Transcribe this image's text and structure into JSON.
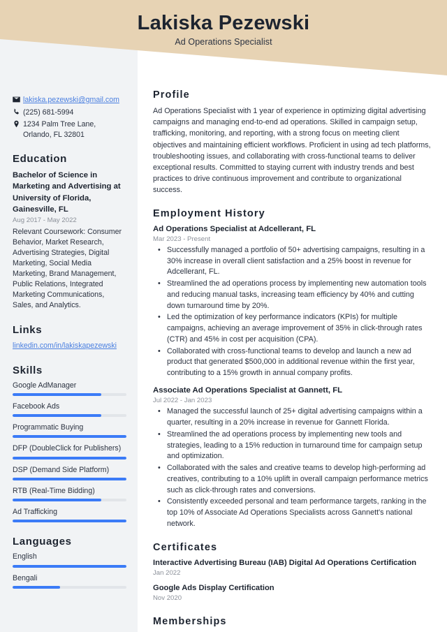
{
  "header": {
    "name": "Lakiska Pezewski",
    "job_title": "Ad Operations Specialist",
    "banner_color": "#E7D3B4"
  },
  "sidebar": {
    "contact": [
      {
        "icon": "envelope-icon",
        "text": "lakiska.pezewski@gmail.com",
        "is_link": true
      },
      {
        "icon": "phone-icon",
        "text": "(225) 681-5994",
        "is_link": false
      },
      {
        "icon": "location-pin-icon",
        "text": "1234 Palm Tree Lane, Orlando, FL 32801",
        "is_link": false
      }
    ],
    "contact_address_line1": "1234 Palm Tree Lane,",
    "contact_address_line2": "Orlando, FL 32801",
    "education": {
      "heading": "Education",
      "entries": [
        {
          "title": "Bachelor of Science in Marketing and Advertising at University of Florida, Gainesville, FL",
          "date": "Aug 2017 - May 2022",
          "description": "Relevant Coursework: Consumer Behavior, Market Research, Advertising Strategies, Digital Marketing, Social Media Marketing, Brand Management, Public Relations, Integrated Marketing Communications, Sales, and Analytics."
        }
      ]
    },
    "links": {
      "heading": "Links",
      "items": [
        {
          "label": "linkedin.com/in/lakiskapezewski"
        }
      ]
    },
    "skills": {
      "heading": "Skills",
      "items": [
        {
          "label": "Google AdManager",
          "level": 78
        },
        {
          "label": "Facebook Ads",
          "level": 78
        },
        {
          "label": "Programmatic Buying",
          "level": 100
        },
        {
          "label": "DFP (DoubleClick for Publishers)",
          "level": 100
        },
        {
          "label": "DSP (Demand Side Platform)",
          "level": 100
        },
        {
          "label": "RTB (Real-Time Bidding)",
          "level": 78
        },
        {
          "label": "Ad Trafficking",
          "level": 100
        }
      ]
    },
    "languages": {
      "heading": "Languages",
      "items": [
        {
          "label": "English",
          "level": 100
        },
        {
          "label": "Bengali",
          "level": 42
        }
      ]
    },
    "accent_color": "#3B7BF7",
    "track_color": "#E2E5E9"
  },
  "main": {
    "profile": {
      "heading": "Profile",
      "text": "Ad Operations Specialist with 1 year of experience in optimizing digital advertising campaigns and managing end-to-end ad operations. Skilled in campaign setup, trafficking, monitoring, and reporting, with a strong focus on meeting client objectives and maintaining efficient workflows. Proficient in using ad tech platforms, troubleshooting issues, and collaborating with cross-functional teams to deliver exceptional results. Committed to staying current with industry trends and best practices to drive continuous improvement and contribute to organizational success."
    },
    "employment": {
      "heading": "Employment History",
      "jobs": [
        {
          "title": "Ad Operations Specialist at Adcellerant, FL",
          "date": "Mar 2023 - Present",
          "bullets": [
            "Successfully managed a portfolio of 50+ advertising campaigns, resulting in a 30% increase in overall client satisfaction and a 25% boost in revenue for Adcellerant, FL.",
            "Streamlined the ad operations process by implementing new automation tools and reducing manual tasks, increasing team efficiency by 40% and cutting down turnaround time by 20%.",
            "Led the optimization of key performance indicators (KPIs) for multiple campaigns, achieving an average improvement of 35% in click-through rates (CTR) and 45% in cost per acquisition (CPA).",
            "Collaborated with cross-functional teams to develop and launch a new ad product that generated $500,000 in additional revenue within the first year, contributing to a 15% growth in annual company profits."
          ]
        },
        {
          "title": "Associate Ad Operations Specialist at Gannett, FL",
          "date": "Jul 2022 - Jan 2023",
          "bullets": [
            "Managed the successful launch of 25+ digital advertising campaigns within a quarter, resulting in a 20% increase in revenue for Gannett Florida.",
            "Streamlined the ad operations process by implementing new tools and strategies, leading to a 15% reduction in turnaround time for campaign setup and optimization.",
            "Collaborated with the sales and creative teams to develop high-performing ad creatives, contributing to a 10% uplift in overall campaign performance metrics such as click-through rates and conversions.",
            "Consistently exceeded personal and team performance targets, ranking in the top 10% of Associate Ad Operations Specialists across Gannett's national network."
          ]
        }
      ]
    },
    "certificates": {
      "heading": "Certificates",
      "items": [
        {
          "title": "Interactive Advertising Bureau (IAB) Digital Ad Operations Certification",
          "date": "Jan 2022"
        },
        {
          "title": "Google Ads Display Certification",
          "date": "Nov 2020"
        }
      ]
    },
    "memberships": {
      "heading": "Memberships"
    }
  }
}
